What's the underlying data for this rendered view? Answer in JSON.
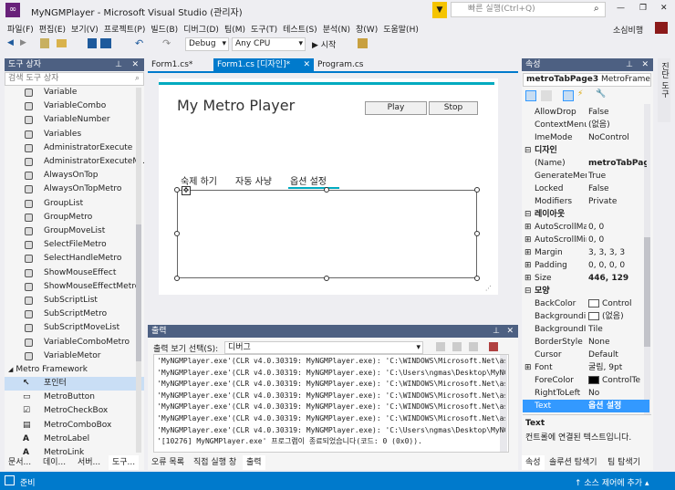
{
  "title": {
    "app": "MyNGMPlayer - Microsoft Visual Studio (관리자)",
    "quick_launch": "빠른 실행(Ctrl+Q)",
    "user": "소심비행",
    "minimize": "—",
    "restore": "❐",
    "close": "✕"
  },
  "menu": [
    "파일(F)",
    "편집(E)",
    "보기(V)",
    "프로젝트(P)",
    "빌드(B)",
    "디버그(D)",
    "팀(M)",
    "도구(T)",
    "테스트(S)",
    "분석(N)",
    "창(W)",
    "도움말(H)"
  ],
  "toolbar": {
    "config": "Debug",
    "platform": "Any CPU",
    "start": "▶ 시작"
  },
  "toolbox": {
    "title": "도구 상자",
    "search_placeholder": "검색 도구 상자",
    "items": [
      "Variable",
      "VariableCombo",
      "VariableNumber",
      "Variables",
      "AdministratorExecute",
      "AdministratorExecuteM...",
      "AlwaysOnTop",
      "AlwaysOnTopMetro",
      "GroupList",
      "GroupMetro",
      "GroupMoveList",
      "SelectFileMetro",
      "SelectHandleMetro",
      "ShowMouseEffect",
      "ShowMouseEffectMetro",
      "SubScriptList",
      "SubScriptMetro",
      "SubScriptMoveList",
      "VariableComboMetro",
      "VariableMetor"
    ],
    "group": "Metro Framework",
    "group_items": [
      "포인터",
      "MetroButton",
      "MetroCheckBox",
      "MetroComboBox",
      "MetroLabel",
      "MetroLink"
    ],
    "bottom_tabs": [
      "문서...",
      "데이...",
      "서버...",
      "도구..."
    ]
  },
  "doc_tabs": [
    "Form1.cs*",
    "Form1.cs [디자인]*",
    "Program.cs"
  ],
  "form": {
    "title": "My Metro Player",
    "play": "Play",
    "stop": "Stop",
    "tabs": [
      "숙제 하기",
      "자동 사냥",
      "옵션 설정"
    ]
  },
  "output": {
    "title": "출력",
    "source_label": "출력 보기 선택(S):",
    "source": "디버그",
    "lines": [
      "'MyNGMPlayer.exe'(CLR v4.0.30319: MyNGMPlayer.exe): 'C:\\WINDOWS\\Microsoft.Net\\assembly\\",
      "'MyNGMPlayer.exe'(CLR v4.0.30319: MyNGMPlayer.exe): 'C:\\Users\\ngmas\\Desktop\\MyNGMPlayer\\",
      "'MyNGMPlayer.exe'(CLR v4.0.30319: MyNGMPlayer.exe): 'C:\\WINDOWS\\Microsoft.Net\\assembly\\",
      "'MyNGMPlayer.exe'(CLR v4.0.30319: MyNGMPlayer.exe): 'C:\\WINDOWS\\Microsoft.Net\\assembly\\",
      "'MyNGMPlayer.exe'(CLR v4.0.30319: MyNGMPlayer.exe): 'C:\\WINDOWS\\Microsoft.Net\\assembly\\",
      "'MyNGMPlayer.exe'(CLR v4.0.30319: MyNGMPlayer.exe): 'C:\\WINDOWS\\Microsoft.Net\\assembly\\",
      "'MyNGMPlayer.exe'(CLR v4.0.30319: MyNGMPlayer.exe): 'C:\\Users\\ngmas\\Desktop\\MyNGMPlayer\\",
      "'[10276] MyNGMPlayer.exe' 프로그램이 종료되었습니다(코드: 0 (0x0))."
    ],
    "bottom_tabs": [
      "오류 목록",
      "직접 실행 창",
      "출력"
    ]
  },
  "properties": {
    "title": "속성",
    "object": "metroTabPage3",
    "object_type": "MetroFramew",
    "rows": [
      [
        "AllowDrop",
        "False"
      ],
      [
        "ContextMenu",
        "(없음)"
      ],
      [
        "ImeMode",
        "NoControl"
      ],
      [
        "디자인",
        ""
      ],
      [
        "(Name)",
        "metroTabPag"
      ],
      [
        "GenerateMem",
        "True"
      ],
      [
        "Locked",
        "False"
      ],
      [
        "Modifiers",
        "Private"
      ],
      [
        "레이아웃",
        ""
      ],
      [
        "AutoScrollMa",
        "0, 0"
      ],
      [
        "AutoScrollMir",
        "0, 0"
      ],
      [
        "Margin",
        "3, 3, 3, 3"
      ],
      [
        "Padding",
        "0, 0, 0, 0"
      ],
      [
        "Size",
        "446, 129"
      ],
      [
        "모양",
        ""
      ],
      [
        "BackColor",
        "Control"
      ],
      [
        "Backgroundin",
        "(없음)"
      ],
      [
        "BackgroundIn",
        "Tile"
      ],
      [
        "BorderStyle",
        "None"
      ],
      [
        "Cursor",
        "Default"
      ],
      [
        "Font",
        "굴림, 9pt"
      ],
      [
        "ForeColor",
        "ControlTe"
      ],
      [
        "RightToLeft",
        "No"
      ],
      [
        "Text",
        "옵션 설정"
      ]
    ],
    "desc_title": "Text",
    "desc": "컨트롤에 연결된 텍스트입니다.",
    "bottom_tabs": [
      "속성",
      "솔루션 탐색기",
      "팀 탐색기"
    ]
  },
  "side_tab": "진단 도구",
  "status": {
    "left": "준비",
    "right": "↑ 소스 제어에 추가 ▴"
  },
  "colors": {
    "accent": "#007acc",
    "panel_header": "#4d6082",
    "status": "#007acc",
    "metro_line": "#00aabf"
  }
}
